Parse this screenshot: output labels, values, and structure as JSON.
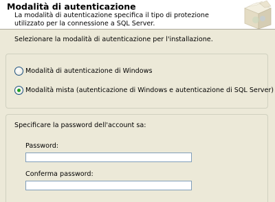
{
  "header": {
    "title": "Modalità di autenticazione",
    "description": "La modalità di autenticazione specifica il tipo di protezione utilizzato per la connessione a SQL Server.",
    "icon": "setup-box-icon"
  },
  "instruction": "Selezionare la modalità di autenticazione per l'installazione.",
  "auth_modes": {
    "windows_label": "Modalità di autenticazione di Windows",
    "windows_selected": false,
    "mixed_label": "Modalità mista (autenticazione di Windows e autenticazione di SQL Server)",
    "mixed_selected": true
  },
  "sa_account": {
    "caption": "Specificare la password dell'account sa:",
    "password_label": "Password:",
    "password_value": "",
    "confirm_label": "Conferma password:",
    "confirm_value": ""
  },
  "colors": {
    "window_bg": "#ece9d8",
    "header_bg": "#ffffff",
    "radio_selected": "#21a121",
    "textbox_border": "#7f9db9"
  }
}
